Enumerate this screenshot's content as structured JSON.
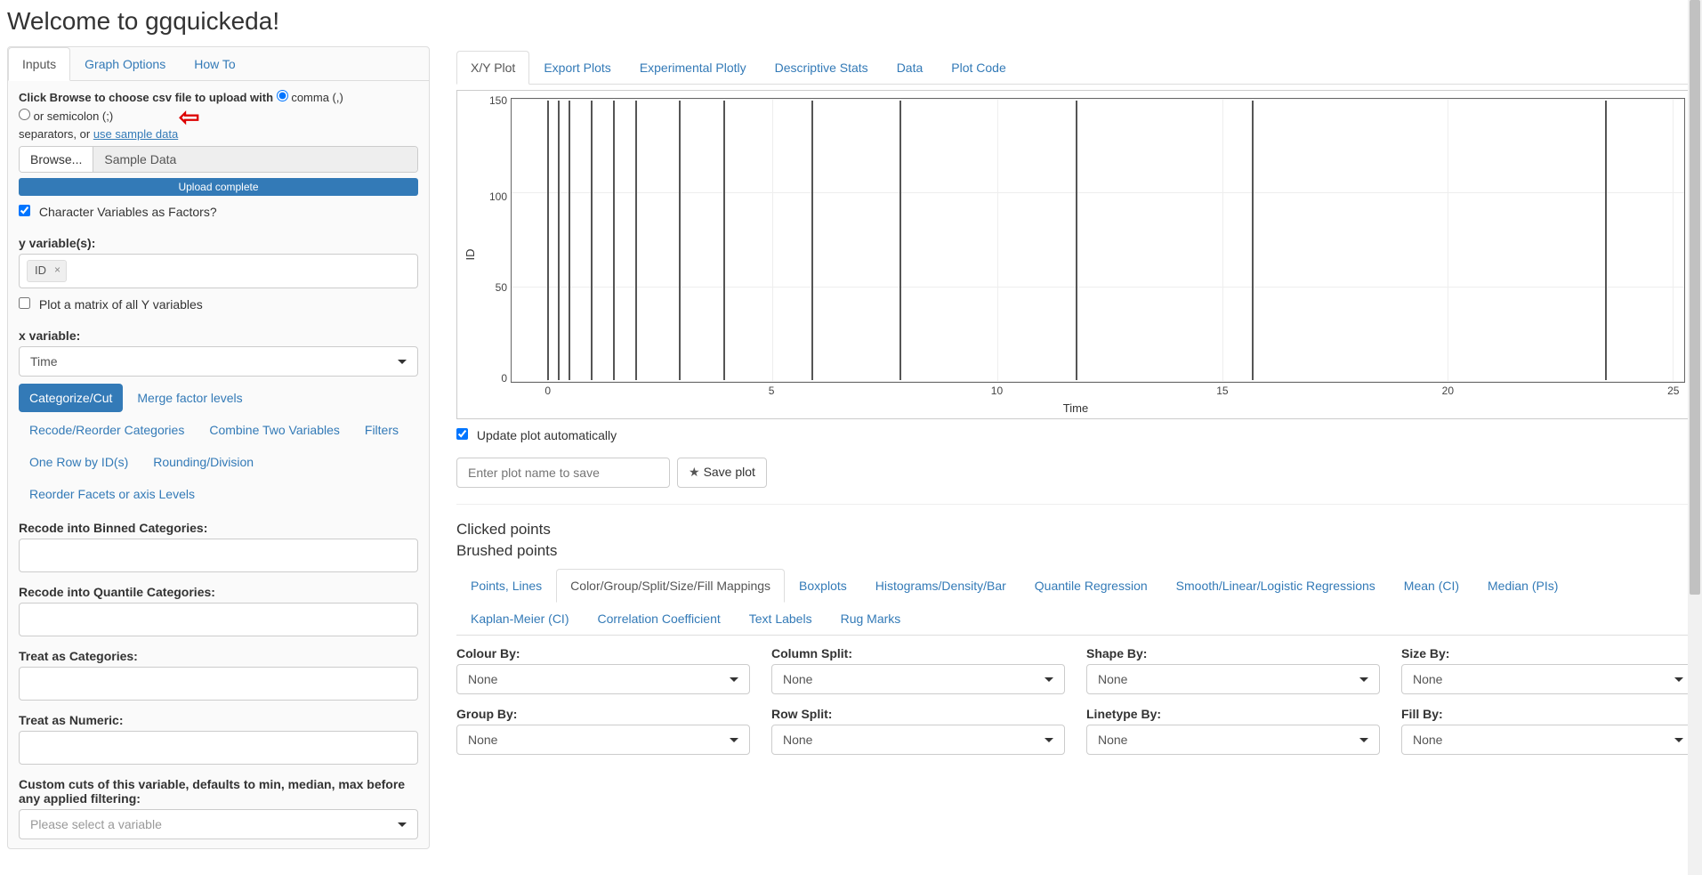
{
  "page": {
    "title": "Welcome to ggquickeda!"
  },
  "left_tabs": [
    {
      "label": "Inputs",
      "active": true
    },
    {
      "label": "Graph Options",
      "active": false
    },
    {
      "label": "How To",
      "active": false
    }
  ],
  "upload": {
    "instruction_prefix": "Click Browse to choose csv file to upload with",
    "sep_comma_label": "comma (,)",
    "sep_semicolon_label": "or semicolon (;)",
    "instruction_suffix": "separators, or ",
    "sample_link": "use sample data",
    "browse_label": "Browse...",
    "filename": "Sample Data",
    "progress_text": "Upload complete"
  },
  "inputs": {
    "char_as_factor_label": "Character Variables as Factors?",
    "char_as_factor_checked": true,
    "yvar_label": "y variable(s):",
    "yvar_tag": "ID",
    "plot_matrix_label": "Plot a matrix of all Y variables",
    "plot_matrix_checked": false,
    "xvar_label": "x variable:",
    "xvar_value": "Time",
    "pill_items": [
      "Categorize/Cut",
      "Merge factor levels",
      "Recode/Reorder Categories",
      "Combine Two Variables",
      "Filters",
      "One Row by ID(s)",
      "Rounding/Division",
      "Reorder Facets or axis Levels"
    ],
    "recode_binned_label": "Recode into Binned Categories:",
    "recode_quantile_label": "Recode into Quantile Categories:",
    "treat_cat_label": "Treat as Categories:",
    "treat_num_label": "Treat as Numeric:",
    "custom_cuts_label": "Custom cuts of this variable, defaults to min, median, max before any applied filtering:",
    "custom_cuts_placeholder": "Please select a variable"
  },
  "right_tabs": [
    {
      "label": "X/Y Plot",
      "active": true
    },
    {
      "label": "Export Plots",
      "active": false
    },
    {
      "label": "Experimental Plotly",
      "active": false
    },
    {
      "label": "Descriptive Stats",
      "active": false
    },
    {
      "label": "Data",
      "active": false
    },
    {
      "label": "Plot Code",
      "active": false
    }
  ],
  "plot": {
    "ylabel": "ID",
    "xlabel": "Time",
    "y_ticks": [
      "0",
      "50",
      "100",
      "150"
    ],
    "x_ticks": [
      "0",
      "5",
      "10",
      "15",
      "20",
      "25"
    ],
    "update_auto_label": "Update plot automatically",
    "update_auto_checked": true,
    "save_placeholder": "Enter plot name to save",
    "save_button": "Save plot"
  },
  "table": {
    "clicked_label": "Clicked points",
    "brushed_label": "Brushed points"
  },
  "plot_option_tabs": [
    "Points, Lines",
    "Color/Group/Split/Size/Fill Mappings",
    "Boxplots",
    "Histograms/Density/Bar",
    "Quantile Regression",
    "Smooth/Linear/Logistic Regressions",
    "Mean (CI)",
    "Median (PIs)",
    "Kaplan-Meier (CI)",
    "Correlation Coefficient",
    "Text Labels",
    "Rug Marks"
  ],
  "mappings": {
    "row1": [
      {
        "label": "Colour By:",
        "value": "None"
      },
      {
        "label": "Column Split:",
        "value": "None"
      },
      {
        "label": "Shape By:",
        "value": "None"
      },
      {
        "label": "Size By:",
        "value": "None"
      }
    ],
    "row2": [
      {
        "label": "Group By:",
        "value": "None"
      },
      {
        "label": "Row Split:",
        "value": "None"
      },
      {
        "label": "Linetype By:",
        "value": "None"
      },
      {
        "label": "Fill By:",
        "value": "None"
      }
    ]
  },
  "chart_data": {
    "type": "bar",
    "title": "",
    "xlabel": "Time",
    "ylabel": "ID",
    "xlim": [
      0,
      25
    ],
    "ylim": [
      0,
      150
    ],
    "x": [
      0,
      0.25,
      0.5,
      1,
      1.5,
      2,
      3,
      4,
      6,
      8,
      12,
      16,
      24
    ],
    "y": [
      150,
      150,
      150,
      150,
      150,
      150,
      150,
      150,
      150,
      150,
      150,
      150,
      150
    ],
    "note": "Vertical strips at sampling time points; heights span full y-range equally."
  }
}
